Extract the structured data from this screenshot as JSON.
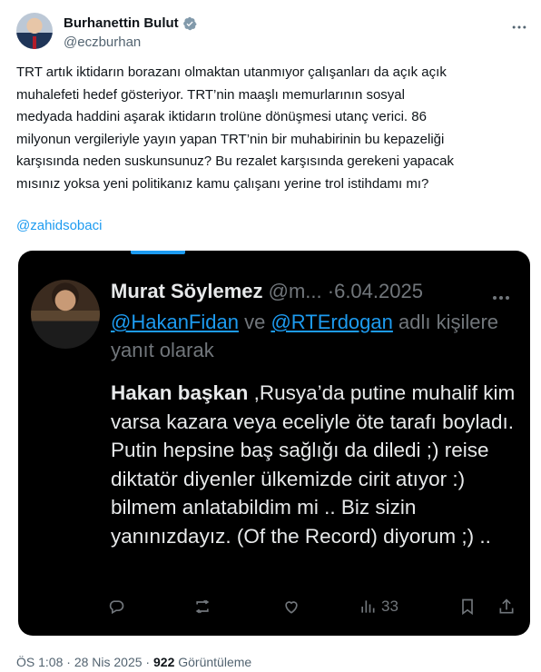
{
  "author": {
    "name": "Burhanettin Bulut",
    "handle": "@eczburhan",
    "verified_color": "#829aab"
  },
  "tweet": {
    "text": "TRT artık iktidarın borazanı olmaktan utanmıyor çalışanları da açık açık\nmuhalefeti hedef gösteriyor. TRT’nin maaşlı memurlarının sosyal\nmedyada haddini aşarak iktidarın trolüne dönüşmesi utanç verici. 86\nmilyonun vergileriyle yayın yapan TRT’nin bir muhabirinin bu kepazeliği\nkarşısında neden suskunsunuz? Bu rezalet karşısında gerekeni yapacak\nmısınız yoksa yeni politikanız kamu çalışanı yerine trol istihdamı mı?",
    "mention": "@zahidsobaci"
  },
  "quote": {
    "name": "Murat Söylemez",
    "handle": "@m...",
    "separator": "·",
    "date": "6.04.2025",
    "reply_mention_1": "@HakanFidan",
    "reply_connector": " ve ",
    "reply_mention_2": "@RTErdogan",
    "reply_suffix": " adlı kişilere yanıt olarak",
    "body_bold": "Hakan başkan",
    "body_rest": " ,Rusya’da putine muhalif kim varsa kazara veya eceliyle öte tarafı boyladı. Putin hepsine baş sağlığı da diledi ;) reise diktatör diyenler ülkemizde cirit atıyor   :) bilmem anlatabildim mi .. Biz sizin yanınızdayız. (Of the Record) diyorum   ;) ..",
    "views_count": "33",
    "icons": [
      "reply-icon",
      "retweet-icon",
      "like-icon",
      "views-icon",
      "bookmark-icon",
      "share-icon"
    ]
  },
  "meta": {
    "time": "ÖS 1:08",
    "separator1": " · ",
    "date": "28 Nis 2025",
    "separator2": " · ",
    "views": "922",
    "views_label": " Görüntüleme"
  },
  "colors": {
    "link": "#1d9bf0",
    "secondary": "#536471",
    "quote_bg": "#000000"
  }
}
